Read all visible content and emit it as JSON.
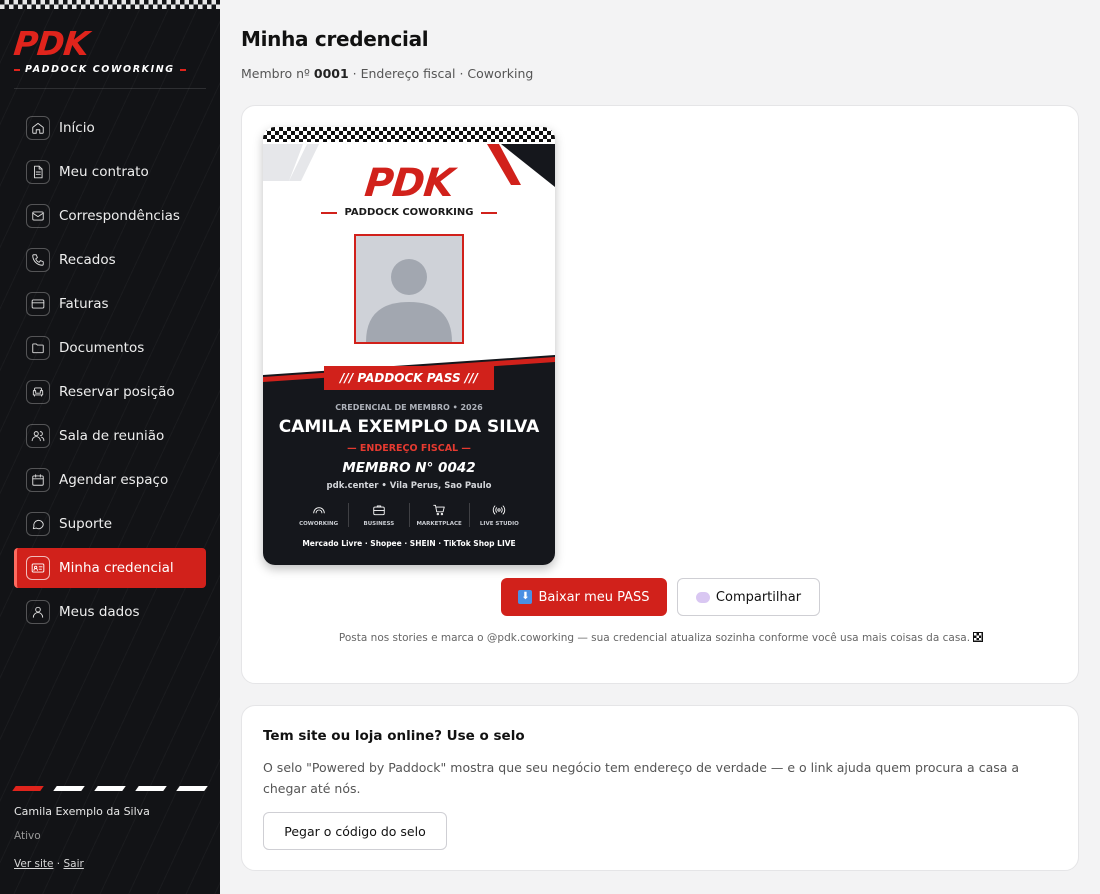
{
  "sidebar": {
    "logo": "PDK",
    "tagline": "PADDOCK COWORKING",
    "items": [
      {
        "label": "Início",
        "icon": "home-icon"
      },
      {
        "label": "Meu contrato",
        "icon": "document-icon"
      },
      {
        "label": "Correspondências",
        "icon": "mail-icon"
      },
      {
        "label": "Recados",
        "icon": "phone-icon"
      },
      {
        "label": "Faturas",
        "icon": "credit-card-icon"
      },
      {
        "label": "Documentos",
        "icon": "folder-icon"
      },
      {
        "label": "Reservar posição",
        "icon": "armchair-icon"
      },
      {
        "label": "Sala de reunião",
        "icon": "users-icon"
      },
      {
        "label": "Agendar espaço",
        "icon": "calendar-icon"
      },
      {
        "label": "Suporte",
        "icon": "chat-bubble-icon"
      },
      {
        "label": "Minha credencial",
        "icon": "id-card-icon",
        "active": true
      },
      {
        "label": "Meus dados",
        "icon": "user-icon"
      }
    ],
    "user_name": "Camila Exemplo da Silva",
    "user_status": "Ativo",
    "link_site": "Ver site",
    "link_separator": "·",
    "link_logout": "Sair"
  },
  "colors": {
    "accent": "#d1211b",
    "sidebar_bg": "#121316",
    "page_bg": "#f3f3f4"
  },
  "header": {
    "title": "Minha credencial",
    "member_prefix": "Membro nº",
    "member_number": "0001",
    "member_suffix": "· Endereço fiscal · Coworking"
  },
  "badge": {
    "logo": "PDK",
    "brand": "PADDOCK COWORKING",
    "pass_label": "/// PADDOCK PASS ///",
    "credential_line": "CREDENCIAL DE MEMBRO • 2026",
    "member_name": "CAMILA EXEMPLO DA SILVA",
    "plan_line": "— ENDEREÇO FISCAL —",
    "member_number_line": "MEMBRO N° 0042",
    "location": "pdk.center • Vila Perus, Sao Paulo",
    "features": [
      {
        "label": "COWORKING",
        "icon": "coworking-icon"
      },
      {
        "label": "BUSINESS",
        "icon": "briefcase-icon"
      },
      {
        "label": "MARKETPLACE",
        "icon": "cart-icon"
      },
      {
        "label": "LIVE STUDIO",
        "icon": "broadcast-icon"
      }
    ],
    "marketplaces": "Mercado Livre · Shopee · SHEIN · TikTok Shop LIVE"
  },
  "actions": {
    "download_label": "Baixar meu PASS",
    "download_icon": "download-arrow-icon",
    "share_label": "Compartilhar",
    "share_icon": "speech-bubble-icon",
    "note": "Posta nos stories e marca o @pdk.coworking — sua credencial atualiza sozinha conforme você usa mais coisas da casa."
  },
  "seal": {
    "title": "Tem site ou loja online? Use o selo",
    "description": "O selo \"Powered by Paddock\" mostra que seu negócio tem endereço de verdade — e o link ajuda quem procura a casa a chegar até nós.",
    "button_label": "Pegar o código do selo"
  }
}
